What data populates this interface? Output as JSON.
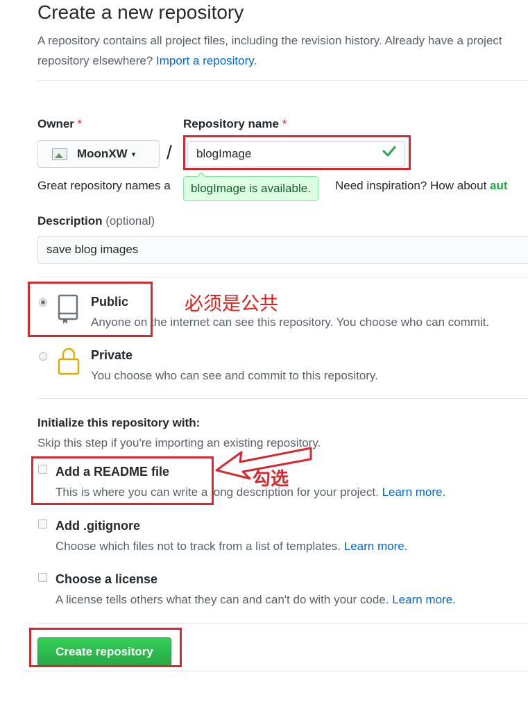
{
  "header": {
    "title": "Create a new repository",
    "intro": "A repository contains all project files, including the revision history. Already have a project repository elsewhere?",
    "import_link": "Import a repository."
  },
  "owner": {
    "label": "Owner",
    "required_mark": "*",
    "value": "MoonXW",
    "caret": "▾",
    "avatar_icon": "broken-image-icon"
  },
  "separator": "/",
  "repo_name": {
    "label": "Repository name",
    "required_mark": "*",
    "value": "blogImage",
    "valid_icon": "check-icon",
    "available_tip": "blogImage is available.",
    "hint_prefix": "Great repository names a",
    "hint_suffix": "Need inspiration? How about",
    "hint_suggestion": "aut"
  },
  "description": {
    "label": "Description",
    "optional": "(optional)",
    "value": "save blog images"
  },
  "visibility": {
    "options": [
      {
        "id": "public",
        "title": "Public",
        "note": "Anyone on the internet can see this repository. You choose who can commit.",
        "icon": "repo-book-icon",
        "selected": true
      },
      {
        "id": "private",
        "title": "Private",
        "note": "You choose who can see and commit to this repository.",
        "icon": "lock-icon",
        "selected": false
      }
    ]
  },
  "initialize": {
    "title": "Initialize this repository with:",
    "skip_note": "Skip this step if you're importing an existing repository.",
    "options": [
      {
        "title": "Add a README file",
        "note": "This is where you can write a long description for your project.",
        "link": "Learn more.",
        "checked": false
      },
      {
        "title": "Add .gitignore",
        "note": "Choose which files not to track from a list of templates.",
        "link": "Learn more.",
        "checked": false
      },
      {
        "title": "Choose a license",
        "note": "A license tells others what they can and can't do with your code.",
        "link": "Learn more.",
        "checked": false
      }
    ]
  },
  "create_button": "Create repository",
  "annotations": {
    "public_note": "必须是公共",
    "readme_note": "勾选",
    "color": "#d8282f"
  },
  "colors": {
    "link": "#0366d6",
    "success_green": "#28a745",
    "tooltip_bg": "#dcffe4"
  }
}
